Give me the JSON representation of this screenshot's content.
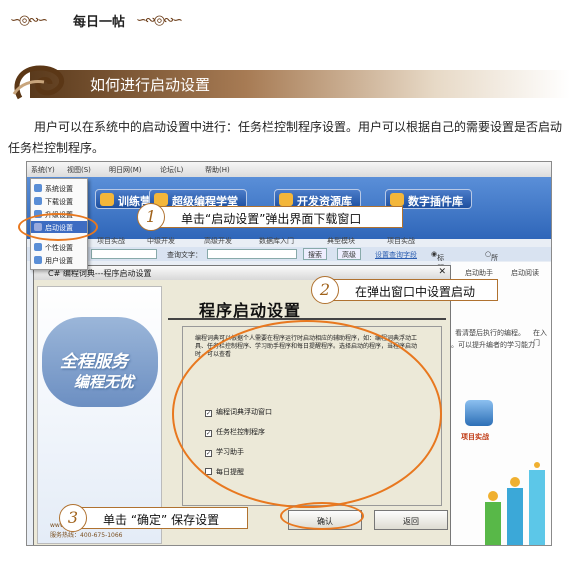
{
  "header": {
    "title": "每日一帖"
  },
  "section": {
    "title": "如何进行启动设置"
  },
  "intro": "用户可以在系统中的启动设置中进行：任务栏控制程序设置。用户可以根据自己的需要设置是否启动任务栏控制程序。",
  "app": {
    "menubar": [
      "系统(Y)",
      "视图(S)",
      "明日网(M)",
      "论坛(L)",
      "帮助(H)"
    ],
    "tabs": [
      "训练营",
      "超级编程学堂",
      "开发资源库",
      "数字插件库"
    ],
    "subnav": [
      "项目实战",
      "中级开发",
      "高级开发",
      "数据库入门",
      "典型模块",
      "项目实战"
    ],
    "toolbar": {
      "query_label": "查询文字：",
      "search_btn": "搜索",
      "advanced_btn": "高级",
      "settings_link": "设置查询字段",
      "radio1": "标题字段",
      "radio2": "所有字段"
    },
    "system_menu": [
      "系统设置",
      "下载设置",
      "升级设置",
      "启动设置",
      "个性设置",
      "用户设置"
    ],
    "right_texts": [
      "启动助手",
      "启动阅读",
      "看清楚后执行的编程。",
      "在入门",
      "。可以提升编者的学习能力"
    ],
    "right_project_label": "项目实战"
  },
  "dialog": {
    "caption": "C# 编程词典---程序启动设置",
    "heading": "程序启动设置",
    "slogan1": "全程服务",
    "slogan2": "编程无忧",
    "url": "www.mrbccd.com",
    "tel": "服务热线：400-675-1066",
    "description": "编程词典可以根据个人需要在程序运行时启动相应的辅助程序，如：编程词典浮动工具、任务栏控制程序、学习助手程序和每日提醒程序。选择启动的程序，当程序启动时，可以查看",
    "options": [
      {
        "label": "编程词典浮动窗口",
        "checked": true
      },
      {
        "label": "任务栏控制程序",
        "checked": true
      },
      {
        "label": "学习助手",
        "checked": true
      },
      {
        "label": "每日提醒",
        "checked": false
      }
    ],
    "ok_button": "确认",
    "back_button": "返回"
  },
  "callouts": [
    {
      "num": "1",
      "text": "单击“启动设置”弹出界面下载窗口"
    },
    {
      "num": "2",
      "text": "在弹出窗口中设置启动"
    },
    {
      "num": "3",
      "text": "单击 “确定” 保存设置"
    }
  ]
}
